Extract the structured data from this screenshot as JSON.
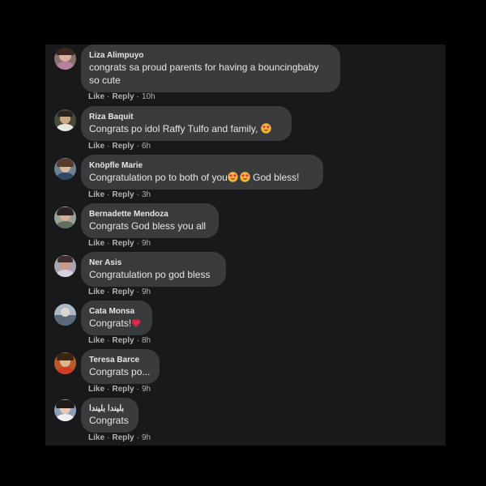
{
  "actions": {
    "like_label": "Like",
    "reply_label": "Reply",
    "separator": "·"
  },
  "comments": [
    {
      "name": "Liza Alimpuyo",
      "text_line1": "congrats sa proud parents for having a bouncingbaby",
      "text_line2": "so cute",
      "time": "10h",
      "emoji": null
    },
    {
      "name": "Riza Baquit",
      "text": "Congrats po idol Raffy Tulfo and family, ",
      "time": "6h",
      "emoji": "heart-eyes-emoji"
    },
    {
      "name": "Knöpfle Marie",
      "text_before": "Congratulation po to both of you",
      "text_after": " God bless!",
      "time": "3h",
      "emoji": "heart-eyes-emoji x2"
    },
    {
      "name": "Bernadette Mendoza",
      "text": "Congrats God bless you all",
      "time": "9h",
      "emoji": null
    },
    {
      "name": "Ner Asis",
      "text": "Congratulation po god bless",
      "time": "9h",
      "emoji": null
    },
    {
      "name": "Cata Monsa",
      "text": "Congrats!",
      "time": "8h",
      "emoji": "red-heart-emoji"
    },
    {
      "name": "Teresa Barce",
      "text": "Congrats po...",
      "time": "9h",
      "emoji": null
    },
    {
      "name": "بليندا بليندا",
      "text": "Congrats",
      "time": "9h",
      "emoji": null
    }
  ],
  "colors": {
    "page_background": "#000000",
    "panel_background": "#18191a",
    "bubble_background": "#3a3b3c",
    "primary_text": "#e4e6eb",
    "secondary_text": "#b0b3b8"
  }
}
